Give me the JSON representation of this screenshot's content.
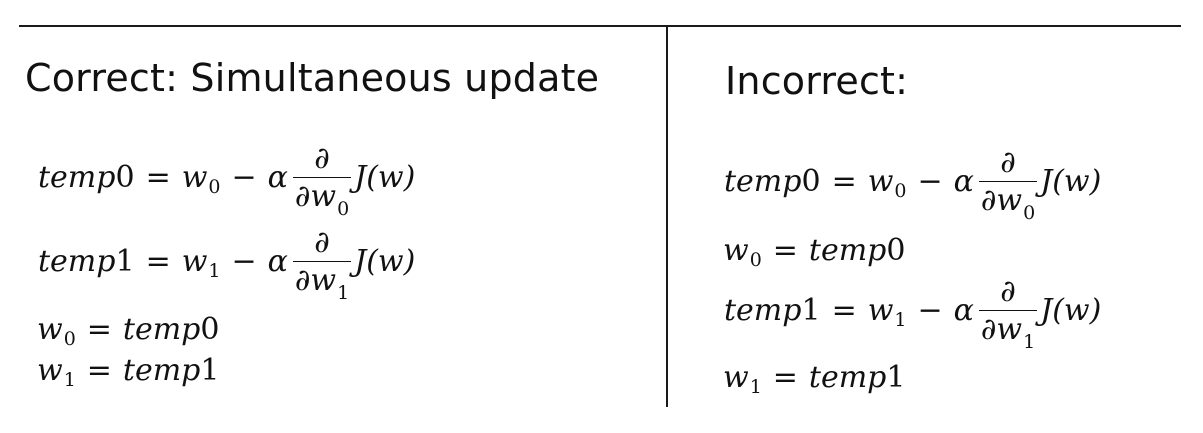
{
  "left": {
    "heading": "Correct: Simultaneous update",
    "equations": [
      {
        "kind": "update",
        "lhs": "temp",
        "lhs_index": "0",
        "op": "=",
        "w": "w",
        "w_sub": "0",
        "minus": "−",
        "alpha": "α",
        "partial": "∂",
        "den_w": "w",
        "den_sub": "0",
        "func": "J(w)"
      },
      {
        "kind": "update",
        "lhs": "temp",
        "lhs_index": "1",
        "op": "=",
        "w": "w",
        "w_sub": "1",
        "minus": "−",
        "alpha": "α",
        "partial": "∂",
        "den_w": "w",
        "den_sub": "1",
        "func": "J(w)"
      },
      {
        "kind": "assign",
        "w": "w",
        "w_sub": "0",
        "op": "=",
        "rhs": "temp",
        "rhs_index": "0"
      },
      {
        "kind": "assign",
        "w": "w",
        "w_sub": "1",
        "op": "=",
        "rhs": "temp",
        "rhs_index": "1"
      }
    ]
  },
  "right": {
    "heading": "Incorrect:",
    "equations": [
      {
        "kind": "update",
        "lhs": "temp",
        "lhs_index": "0",
        "op": "=",
        "w": "w",
        "w_sub": "0",
        "minus": "−",
        "alpha": "α",
        "partial": "∂",
        "den_w": "w",
        "den_sub": "0",
        "func": "J(w)"
      },
      {
        "kind": "assign",
        "w": "w",
        "w_sub": "0",
        "op": "=",
        "rhs": "temp",
        "rhs_index": "0"
      },
      {
        "kind": "update",
        "lhs": "temp",
        "lhs_index": "1",
        "op": "=",
        "w": "w",
        "w_sub": "1",
        "minus": "−",
        "alpha": "α",
        "partial": "∂",
        "den_w": "w",
        "den_sub": "1",
        "func": "J(w)"
      },
      {
        "kind": "assign",
        "w": "w",
        "w_sub": "1",
        "op": "=",
        "rhs": "temp",
        "rhs_index": "1"
      }
    ]
  }
}
